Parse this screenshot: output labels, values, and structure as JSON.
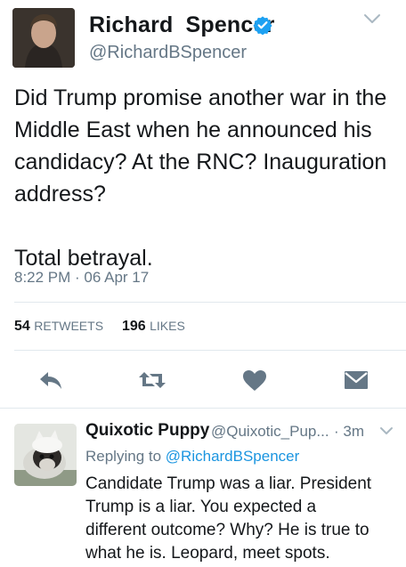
{
  "tweet": {
    "display_name_first": "Richard",
    "display_name_last": "Spencer",
    "handle": "@RichardBSpencer",
    "text": "Did Trump promise another war in the\nMiddle East when he announced his\ncandidacy? At the RNC? Inauguration\naddress?\n\nTotal betrayal.",
    "timestamp": "8:22 PM · 06 Apr 17",
    "retweets_count": "54",
    "retweets_label": "RETWEETS",
    "likes_count": "196",
    "likes_label": "LIKES",
    "verified": true
  },
  "icons": {
    "reply": "reply-arrow-icon",
    "retweet": "retweet-icon",
    "like": "heart-icon",
    "dm": "envelope-icon",
    "menu": "chevron-down-icon",
    "verified": "verified-badge-icon"
  },
  "reply": {
    "display_name": "Quixotic Puppy",
    "handle": "@Quixotic_Pup...",
    "time": "· 3m",
    "replying_prefix": "Replying to",
    "replying_to": "@RichardBSpencer",
    "text": "Candidate Trump was a liar. President\nTrump is a liar. You expected a\ndifferent outcome? Why? He is true to\nwhat he is. Leopard, meet spots."
  },
  "colors": {
    "text_primary": "#14171a",
    "text_secondary": "#657786",
    "link": "#1b95e0",
    "verified": "#1da1f2",
    "action_icon": "#657786",
    "divider": "#e1e8ed"
  }
}
